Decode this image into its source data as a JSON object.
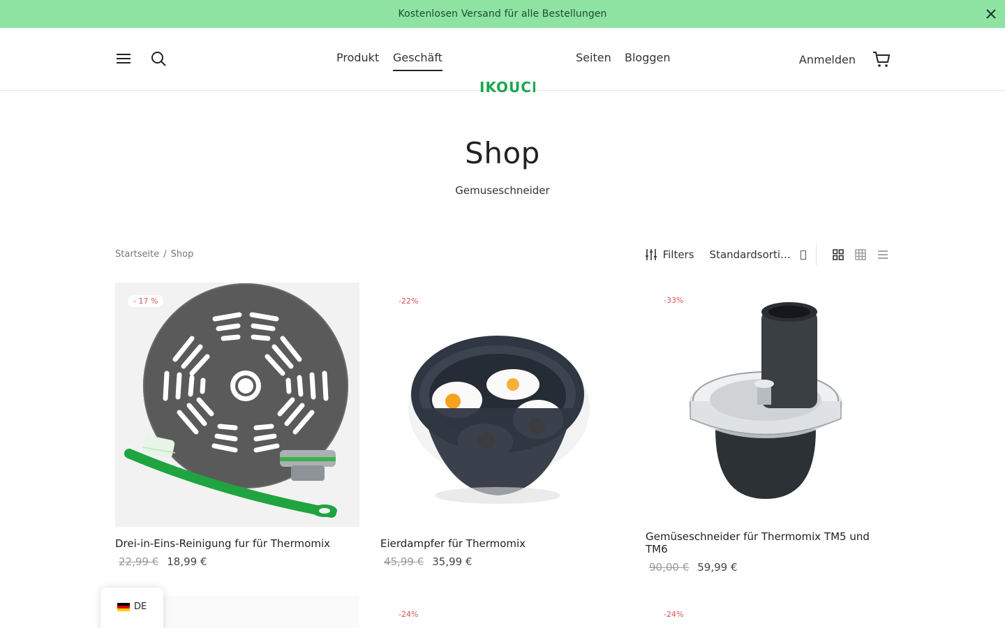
{
  "announcement": {
    "text": "Kostenlosen Versand für alle Bestellungen"
  },
  "header": {
    "logo_text": "IKOUCH",
    "nav": [
      "Produkt",
      "Geschäft",
      "Seiten",
      "Bloggen"
    ],
    "signin": "Anmelden"
  },
  "hero": {
    "title": "Shop",
    "subtitle": "Gemuseschneider"
  },
  "breadcrumb": {
    "home": "Startseite",
    "sep": "/",
    "current": "Shop"
  },
  "toolbar": {
    "filters": "Filters",
    "sort": "Standardsorti…"
  },
  "products": [
    {
      "badge": "- 17 %",
      "name": "Drei-in-Eins-Reinigung fur für Thermomix",
      "old_price": "22,99 €",
      "price": "18,99 €"
    },
    {
      "badge": "-22%",
      "name": "Eierdampfer für Thermomix",
      "old_price": "45,99 €",
      "price": "35,99 €"
    },
    {
      "badge": "-33%",
      "name": "Gemüseschneider für Thermomix TM5 und TM6",
      "old_price": "90,00 €",
      "price": "59,99 €"
    },
    {
      "badge": "",
      "name": "",
      "old_price": "",
      "price": ""
    },
    {
      "badge": "-24%",
      "name": "",
      "old_price": "",
      "price": ""
    },
    {
      "badge": "-24%",
      "name": "",
      "old_price": "",
      "price": ""
    }
  ],
  "language": {
    "code": "DE"
  },
  "colors": {
    "announce_bg": "#8ee3a2",
    "brand_green": "#1aa84f",
    "sale_red": "#d9534f"
  }
}
